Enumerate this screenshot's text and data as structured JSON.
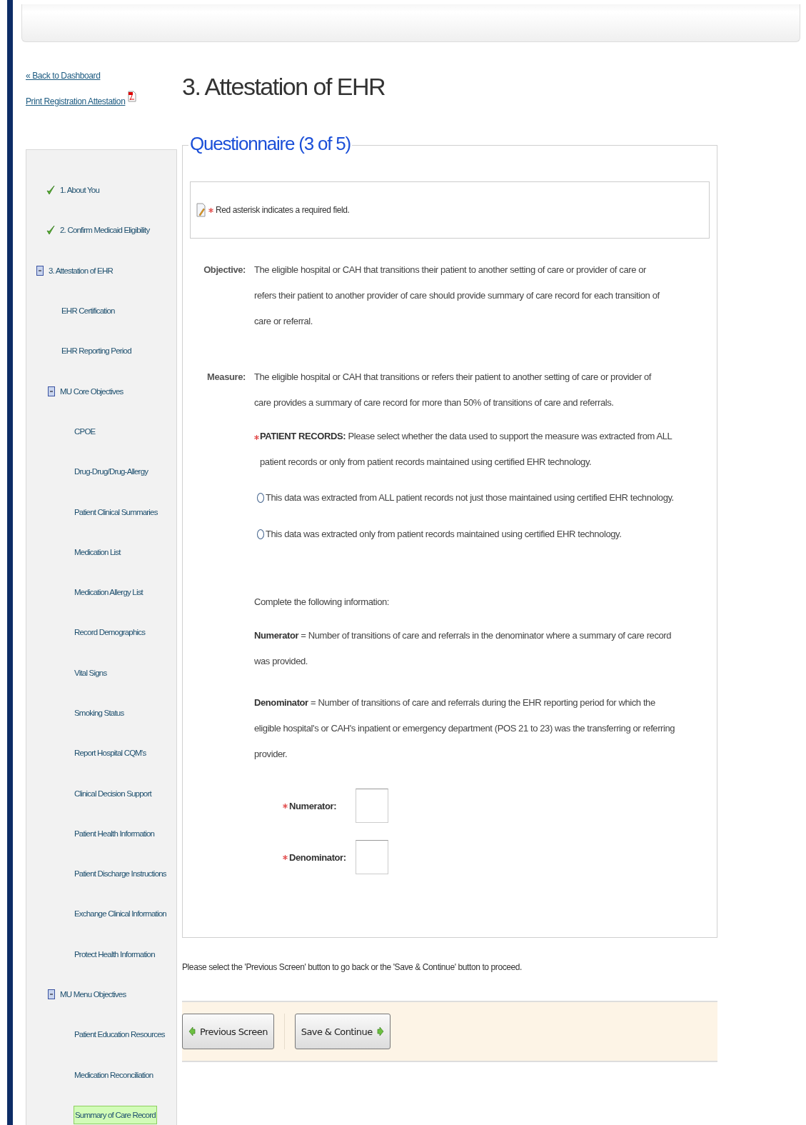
{
  "links": [
    {
      "label": "« Back to Dashboard",
      "kind": "back"
    },
    {
      "label": "Print Registration Attestation",
      "kind": "pdf"
    }
  ],
  "sidebar": {
    "items": [
      {
        "label": "1. About You",
        "completed": true,
        "selected": false
      },
      {
        "label": "2. Confirm Medicaid Eligibility",
        "completed": true,
        "selected": false
      },
      {
        "label": "3. Attestation of EHR",
        "completed": false,
        "selected": false,
        "expanded": true,
        "children": [
          {
            "label": "EHR Certification",
            "selected": false
          },
          {
            "label": "EHR Reporting Period",
            "selected": false
          },
          {
            "label": "MU Core Objectives",
            "selected": false,
            "expanded": true,
            "children": [
              {
                "label": "CPOE",
                "selected": false
              },
              {
                "label": "Drug-Drug/Drug-Allergy",
                "selected": false
              },
              {
                "label": "Patient Clinical Summaries",
                "selected": false
              },
              {
                "label": "Medication List",
                "selected": false
              },
              {
                "label": "Medication Allergy List",
                "selected": false
              },
              {
                "label": "Record Demographics",
                "selected": false
              },
              {
                "label": "Vital Signs",
                "selected": false
              },
              {
                "label": "Smoking Status",
                "selected": false
              },
              {
                "label": "Report Hospital CQM's",
                "selected": false
              },
              {
                "label": "Clinical Decision Support",
                "selected": false
              },
              {
                "label": "Patient Health Information",
                "selected": false
              },
              {
                "label": "Patient Discharge Instructions",
                "selected": false
              },
              {
                "label": "Exchange Clinical Information",
                "selected": false
              },
              {
                "label": "Protect Health Information",
                "selected": false
              }
            ]
          },
          {
            "label": "MU Menu Objectives",
            "selected": false,
            "expanded": true,
            "children": [
              {
                "label": "Patient Education Resources",
                "selected": false
              },
              {
                "label": "Medication Reconciliation",
                "selected": false
              },
              {
                "label": "Summary of Care Record",
                "selected": true
              }
            ]
          }
        ]
      }
    ]
  },
  "page_title": "3. Attestation of EHR",
  "questionnaire": {
    "legend": "Questionnaire (3 of 5)",
    "note": "Red asterisk indicates a required field.",
    "sections": [
      {
        "label": "Objective:",
        "text": "The eligible hospital or CAH that transitions their patient to another setting of care or provider of care or refers their patient to another provider of care should provide summary of care record for each transition of care or referral."
      },
      {
        "label": "Measure:",
        "text": "The eligible hospital or CAH that transitions or refers their patient to another setting of care or provider of care provides a summary of care record for more than 50% of transitions of care and referrals."
      }
    ],
    "question": {
      "required": true,
      "text": "**PATIENT RECORDS:** Please select whether the data used to support the measure was extracted from ALL patient records or only from patient records maintained using certified EHR technology."
    },
    "options": [
      {
        "label": "This data was extracted from ALL patient records not just those maintained using certified EHR technology.",
        "selected": false
      },
      {
        "label": "This data was extracted only from patient records maintained using certified EHR technology.",
        "selected": false
      }
    ],
    "instruction": "Complete the following information:",
    "definitions": [
      "**Numerator** = Number of transitions of care and referrals in the denominator where a summary of care record was provided.",
      "**Denominator** = Number of transitions of care and referrals during the EHR reporting period for which the eligible hospital's or CAH's inpatient or emergency department (POS 21 to 23) was the transferring or referring provider."
    ],
    "fields": [
      {
        "label": "Numerator:",
        "required": true
      },
      {
        "label": "Denominator:",
        "required": true
      }
    ]
  },
  "footer_note": "Please select the 'Previous Screen' button to go back or the 'Save & Continue' button to proceed.",
  "buttons": [
    {
      "label": "Previous Screen",
      "kind": "back"
    },
    {
      "label": "Save & Continue",
      "kind": "next"
    }
  ]
}
